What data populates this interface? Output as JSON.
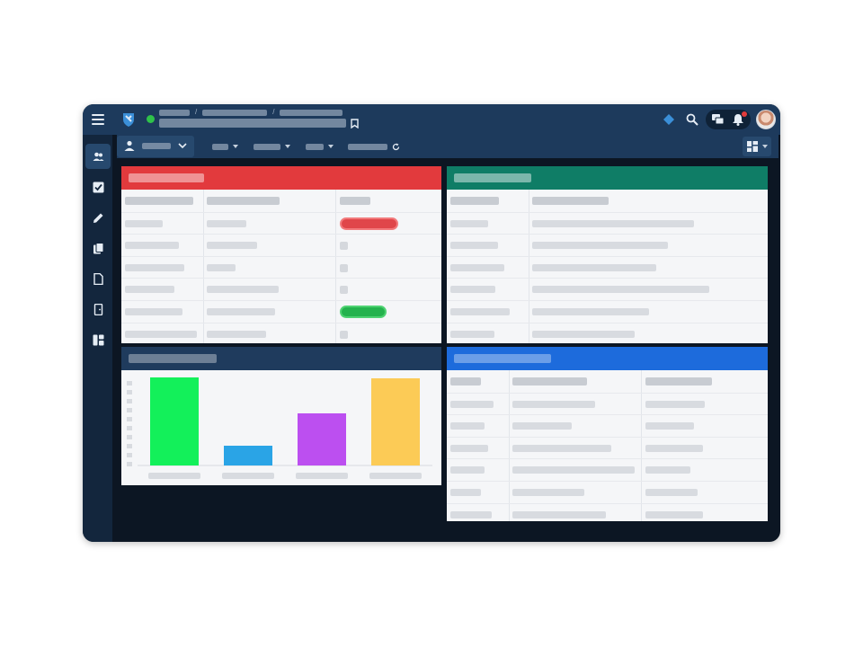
{
  "colors": {
    "topbar": "#1d3a5c",
    "sidebar": "#13263d",
    "red_panel": "#e23a3d",
    "green_panel": "#0f7d66",
    "navy_panel": "#1f3b5d",
    "blue_panel": "#1d6bdc",
    "status_red": "#e0464a",
    "status_green": "#24b24d"
  },
  "header": {
    "menu_icon": "hamburger-icon",
    "logo_icon": "shield-logo-icon",
    "status": "online",
    "right_icons": [
      "diamond-icon",
      "search-icon",
      "chat-icon",
      "bell-icon",
      "avatar"
    ]
  },
  "sidebar": {
    "items": [
      {
        "icon": "users-icon",
        "active": true
      },
      {
        "icon": "checkbox-icon",
        "active": false
      },
      {
        "icon": "pencil-icon",
        "active": false
      },
      {
        "icon": "documents-icon",
        "active": false
      },
      {
        "icon": "file-icon",
        "active": false
      },
      {
        "icon": "door-icon",
        "active": false
      },
      {
        "icon": "dashboard-icon",
        "active": false
      }
    ]
  },
  "toolbar": {
    "user_icon": "user-icon",
    "filters": 4,
    "layout_icon": "layout-grid-icon"
  },
  "panels": {
    "top_left": {
      "rows": 6,
      "status_pills": [
        {
          "row": 0,
          "color": "red"
        },
        {
          "row": 4,
          "color": "green"
        }
      ]
    },
    "top_right": {
      "rows": 6
    },
    "bottom_left": {
      "type": "bar-chart"
    },
    "bottom_right": {
      "rows": 6
    }
  },
  "chart_data": {
    "type": "bar",
    "categories": [
      "",
      "",
      "",
      ""
    ],
    "values": [
      98,
      22,
      58,
      97
    ],
    "colors": [
      "#13f05a",
      "#2aa4e6",
      "#bc4ff0",
      "#fccb56"
    ],
    "ylim": [
      0,
      100
    ],
    "grid": false
  }
}
